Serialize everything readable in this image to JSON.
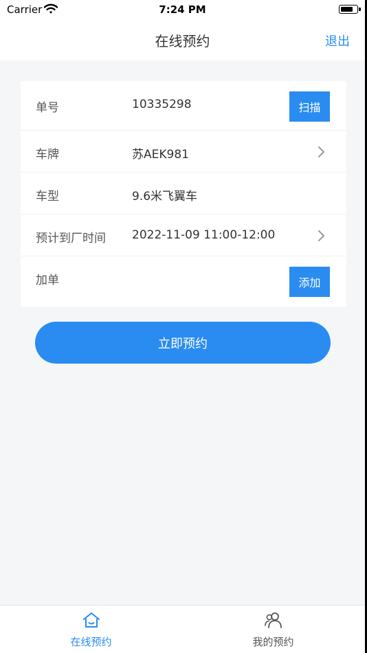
{
  "status_bar": {
    "carrier": "Carrier",
    "time": "7:24 PM"
  },
  "nav": {
    "title": "在线预约",
    "right_action": "退出"
  },
  "form": {
    "order_no": {
      "label": "单号",
      "value": "10335298",
      "button": "扫描"
    },
    "plate": {
      "label": "车牌",
      "value": "苏AEK981"
    },
    "vehicle_type": {
      "label": "车型",
      "value": "9.6米飞翼车"
    },
    "eta": {
      "label": "预计到厂时间",
      "value": "2022-11-09 11:00-12:00"
    },
    "extra_order": {
      "label": "加单",
      "button": "添加"
    }
  },
  "submit_label": "立即预约",
  "tabs": [
    {
      "label": "在线预约",
      "icon": "home-icon",
      "active": true
    },
    {
      "label": "我的预约",
      "icon": "users-icon",
      "active": false
    }
  ],
  "colors": {
    "accent": "#2a8cf0",
    "background": "#f5f6f8"
  }
}
